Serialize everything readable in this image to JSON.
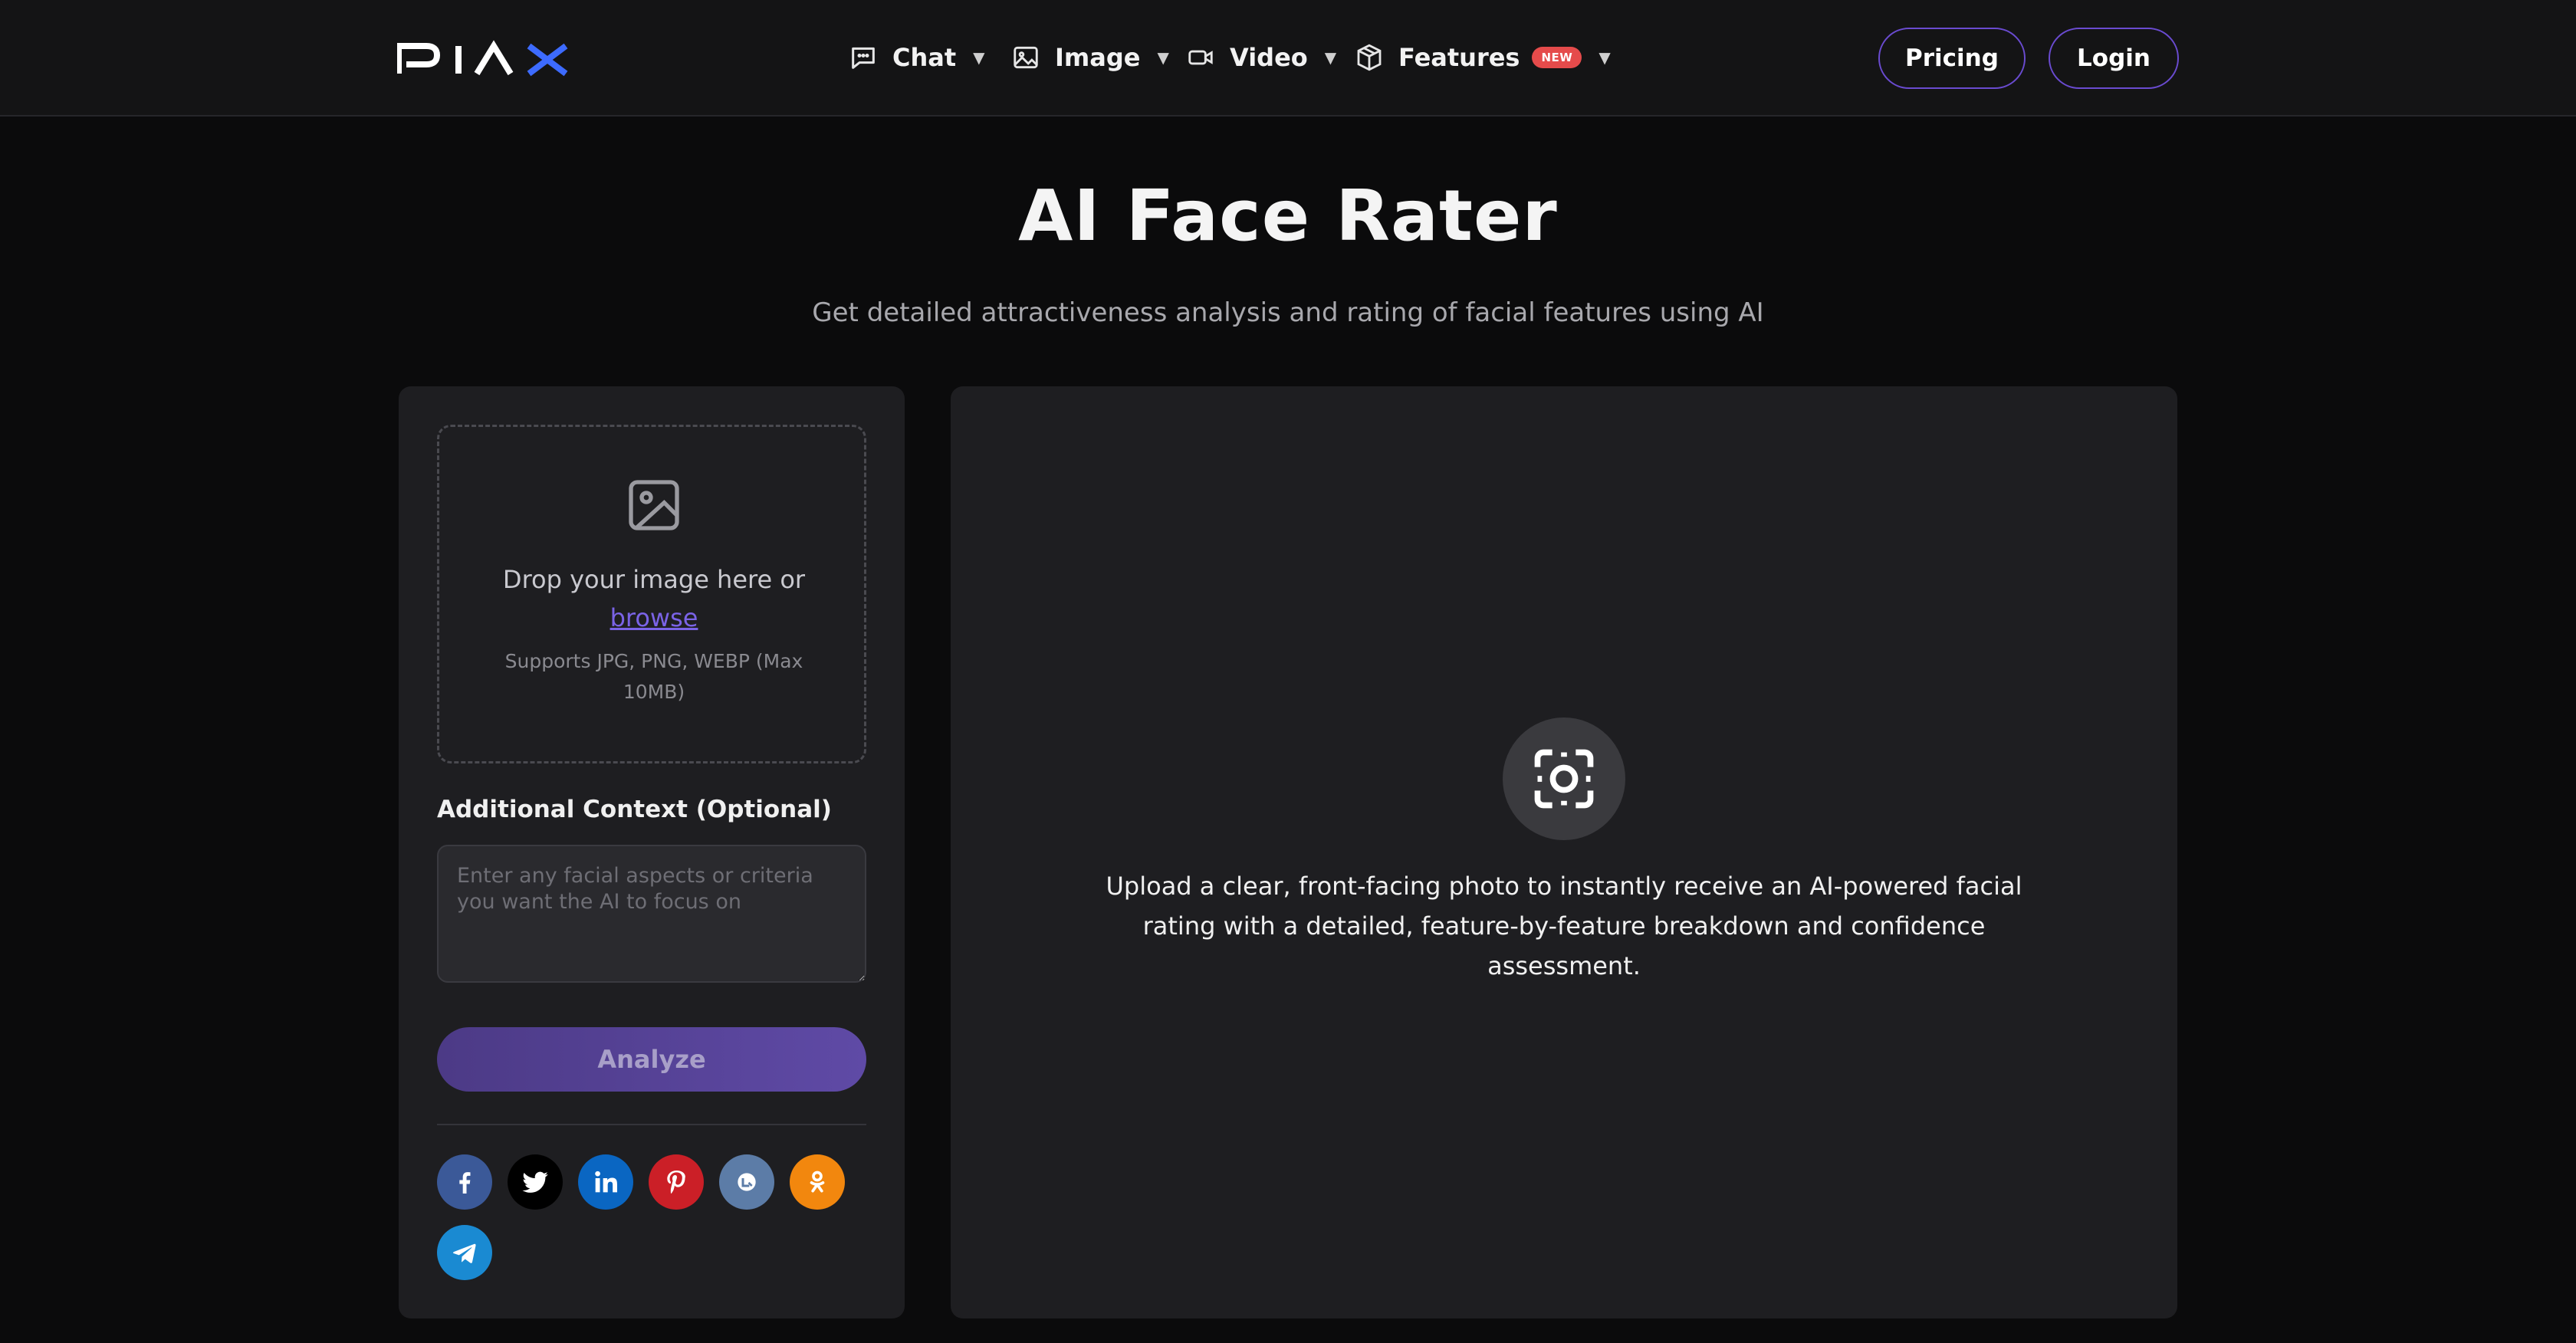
{
  "header": {
    "logo_text": "PIAX",
    "nav": {
      "chat": "Chat",
      "image": "Image",
      "video": "Video",
      "features": "Features",
      "features_badge": "NEW"
    },
    "pricing_label": "Pricing",
    "login_label": "Login"
  },
  "hero": {
    "title": "AI Face Rater",
    "subtitle": "Get detailed attractiveness analysis and rating of facial features using AI"
  },
  "upload": {
    "drop_text": "Drop your image here or",
    "browse_label": "browse",
    "hint": "Supports JPG, PNG, WEBP (Max 10MB)"
  },
  "context": {
    "label": "Additional Context (Optional)",
    "placeholder": "Enter any facial aspects or criteria you want the AI to focus on",
    "value": ""
  },
  "analyze_label": "Analyze",
  "social": [
    {
      "name": "facebook-icon",
      "color": "#3b5998"
    },
    {
      "name": "twitter-icon",
      "color": "#000000"
    },
    {
      "name": "linkedin-icon",
      "color": "#0a66c2"
    },
    {
      "name": "pinterest-icon",
      "color": "#cb1f27"
    },
    {
      "name": "livejournal-icon",
      "color": "#5c7ca7"
    },
    {
      "name": "odnoklassniki-icon",
      "color": "#f2870e"
    },
    {
      "name": "telegram-icon",
      "color": "#1a8ad2"
    }
  ],
  "result": {
    "placeholder_text": "Upload a clear, front-facing photo to instantly receive an AI-powered facial rating with a detailed, feature-by-feature breakdown and confidence assessment."
  },
  "colors": {
    "accent": "#6a4bd0",
    "link": "#7a63e6",
    "background": "#0b0b0c",
    "panel": "#1e1e21"
  }
}
